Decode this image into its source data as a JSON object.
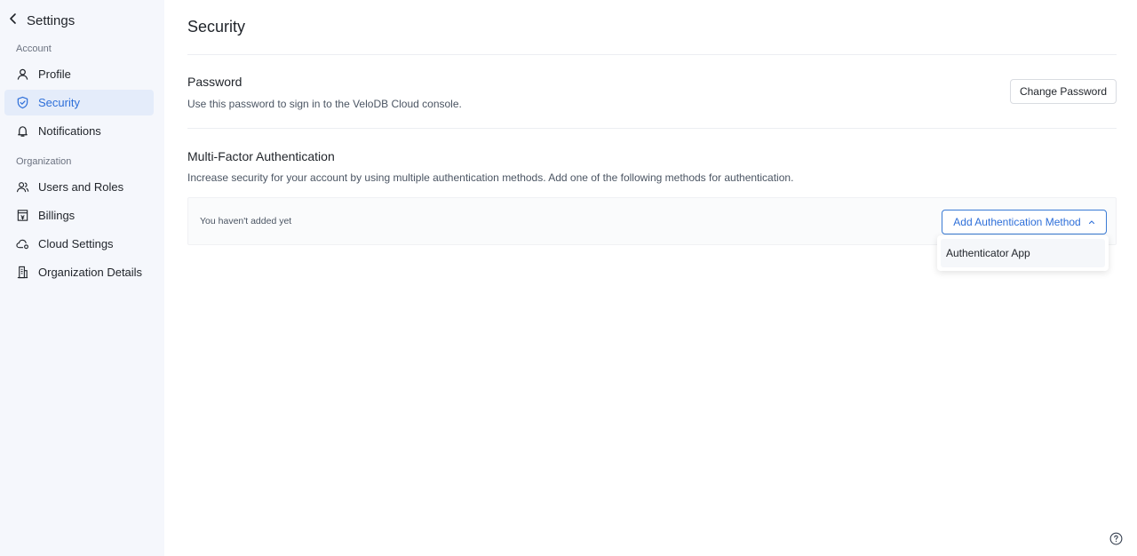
{
  "sidebar": {
    "title": "Settings",
    "groups": [
      {
        "label": "Account",
        "items": [
          {
            "label": "Profile",
            "icon": "user-icon"
          },
          {
            "label": "Security",
            "icon": "shield-icon",
            "active": true
          },
          {
            "label": "Notifications",
            "icon": "bell-icon"
          }
        ]
      },
      {
        "label": "Organization",
        "items": [
          {
            "label": "Users and Roles",
            "icon": "users-icon"
          },
          {
            "label": "Billings",
            "icon": "billing-icon"
          },
          {
            "label": "Cloud Settings",
            "icon": "cloud-gear-icon"
          },
          {
            "label": "Organization Details",
            "icon": "building-icon"
          }
        ]
      }
    ]
  },
  "main": {
    "title": "Security",
    "password": {
      "title": "Password",
      "description": "Use this password to sign in to the VeloDB Cloud console.",
      "button_label": "Change Password"
    },
    "mfa": {
      "title": "Multi-Factor Authentication",
      "description": "Increase security for your account by using multiple authentication methods. Add one of the following methods for authentication.",
      "empty_text": "You haven't added yet",
      "add_button_label": "Add Authentication Method",
      "dropdown_options": [
        "Authenticator App"
      ]
    }
  },
  "colors": {
    "accent": "#2e6fd9",
    "sidebar_bg": "#f5f7fc",
    "active_bg": "#e4ecfa"
  },
  "help_icon": "help-circle-icon"
}
